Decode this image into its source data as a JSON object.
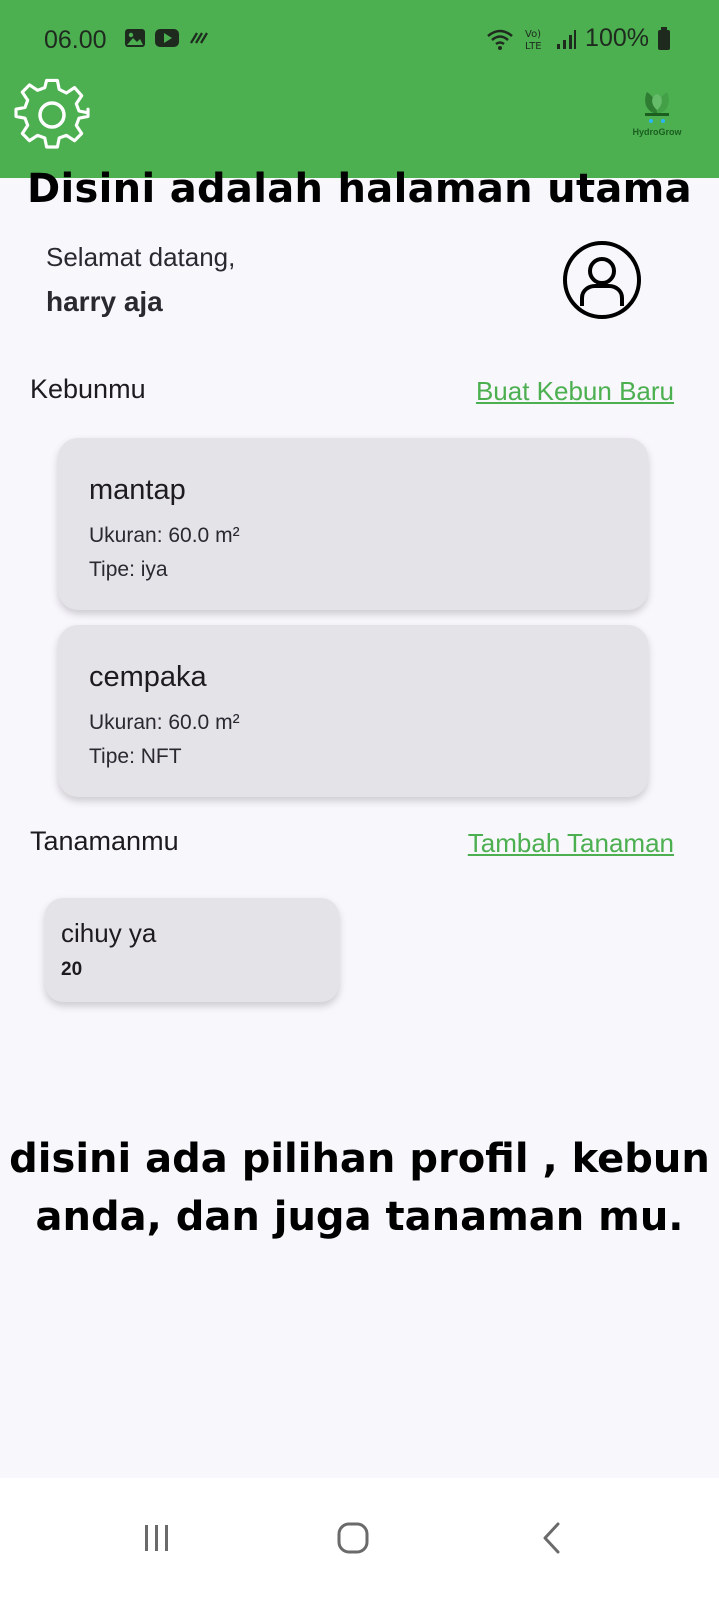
{
  "status_bar": {
    "time": "06.00",
    "battery": "100%",
    "icons": [
      "gallery-icon",
      "youtube-icon",
      "data-icon",
      "wifi-icon",
      "volte-icon",
      "signal-icon",
      "battery-icon"
    ]
  },
  "app_bar": {
    "settings_icon": "gear-icon",
    "logo_text": "HydroGrow",
    "background_color": "#4caf50"
  },
  "overlay": {
    "title": "Disini adalah halaman utama",
    "caption_line1": "disini ada pilihan profil , kebun",
    "caption_line2": "anda, dan juga tanaman mu."
  },
  "welcome": {
    "greeting": "Selamat datang,",
    "username": "harry aja",
    "avatar_icon": "profile-icon"
  },
  "gardens": {
    "title": "Kebunmu",
    "link": "Buat Kebun Baru",
    "items": [
      {
        "name": "mantap",
        "size": "Ukuran: 60.0 m²",
        "type": "Tipe: iya"
      },
      {
        "name": "cempaka",
        "size": "Ukuran: 60.0 m²",
        "type": "Tipe: NFT"
      }
    ]
  },
  "plants": {
    "title": "Tanamanmu",
    "link": "Tambah Tanaman",
    "items": [
      {
        "name": "cihuy ya",
        "quantity": "20"
      }
    ]
  },
  "nav_bar": {
    "buttons": [
      "recents-icon",
      "home-icon",
      "back-icon"
    ]
  },
  "colors": {
    "accent": "#4caf50",
    "card": "#e4e3e8",
    "background": "#f8f7fc"
  }
}
